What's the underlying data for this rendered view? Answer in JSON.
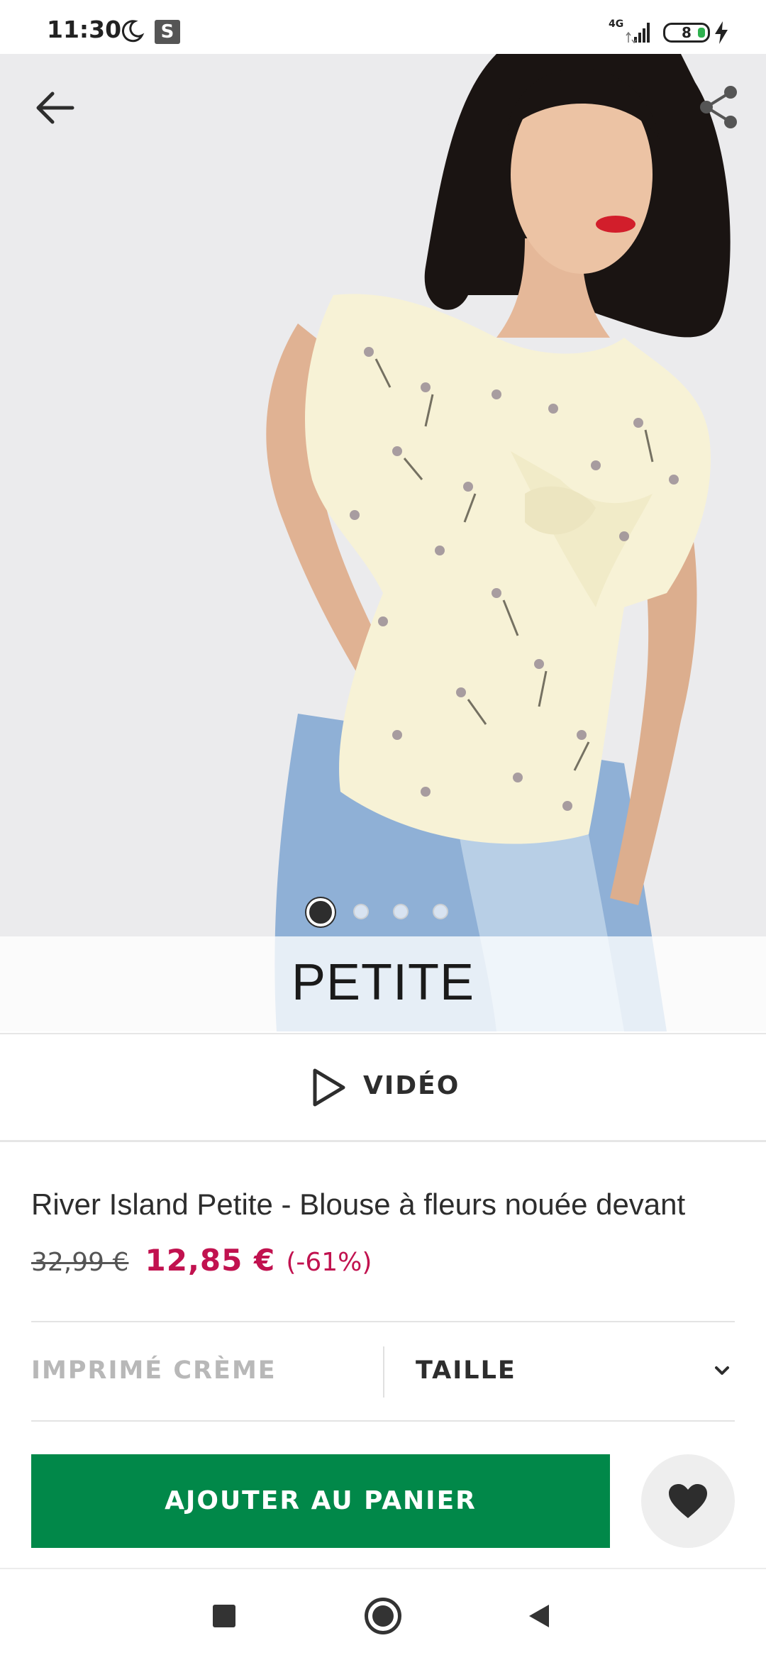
{
  "status_bar": {
    "time": "11:30",
    "s_badge": "S",
    "network": "4G",
    "battery": "8"
  },
  "hero": {
    "badge": "PETITE",
    "slide_count": 4,
    "active_slide": 1
  },
  "video": {
    "label": "VIDÉO"
  },
  "product": {
    "title": "River Island Petite - Blouse à fleurs nouée devant",
    "price_old": "32,99 €",
    "price_new": "12,85 €",
    "discount": "(-61%)"
  },
  "selectors": {
    "color": "IMPRIMÉ CRÈME",
    "size": "TAILLE"
  },
  "actions": {
    "add_to_cart": "AJOUTER AU PANIER"
  },
  "colors": {
    "accent_green": "#018849",
    "sale_red": "#c1124f",
    "text": "#2d2d2d"
  }
}
